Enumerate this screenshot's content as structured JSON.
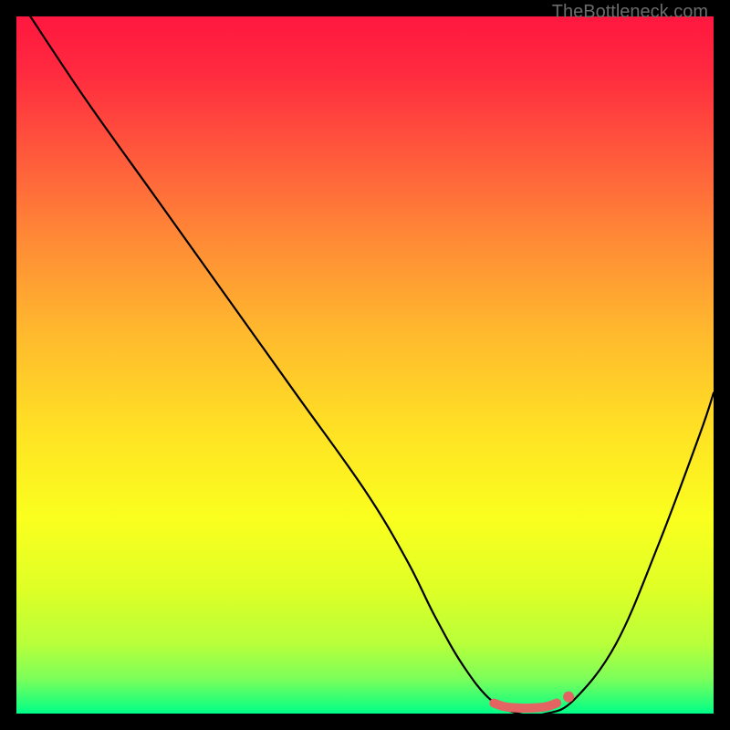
{
  "watermark": "TheBottleneck.com",
  "chart_data": {
    "type": "line",
    "title": "",
    "xlabel": "",
    "ylabel": "",
    "xlim": [
      0,
      100
    ],
    "ylim": [
      0,
      100
    ],
    "grid": false,
    "series": [
      {
        "name": "bottleneck-curve",
        "x": [
          2,
          10,
          20,
          30,
          40,
          50,
          56,
          60,
          64,
          68,
          72,
          76,
          80,
          86,
          92,
          98,
          100
        ],
        "y": [
          100,
          88,
          74,
          60,
          46,
          32,
          22,
          14,
          7,
          2,
          0,
          0,
          2,
          10,
          24,
          40,
          46
        ]
      }
    ],
    "markers": [
      {
        "name": "flat-region-marker",
        "x": [
          68.5,
          70,
          72,
          74,
          76,
          77.5
        ],
        "y": [
          1.5,
          1.0,
          0.8,
          0.8,
          1.0,
          1.5
        ],
        "color": "#e46363"
      },
      {
        "name": "end-dot",
        "x": 79.2,
        "y": 2.4,
        "color": "#e46363"
      }
    ],
    "background_gradient": {
      "top": "#ff173f",
      "bottom": "#00ff88"
    }
  }
}
